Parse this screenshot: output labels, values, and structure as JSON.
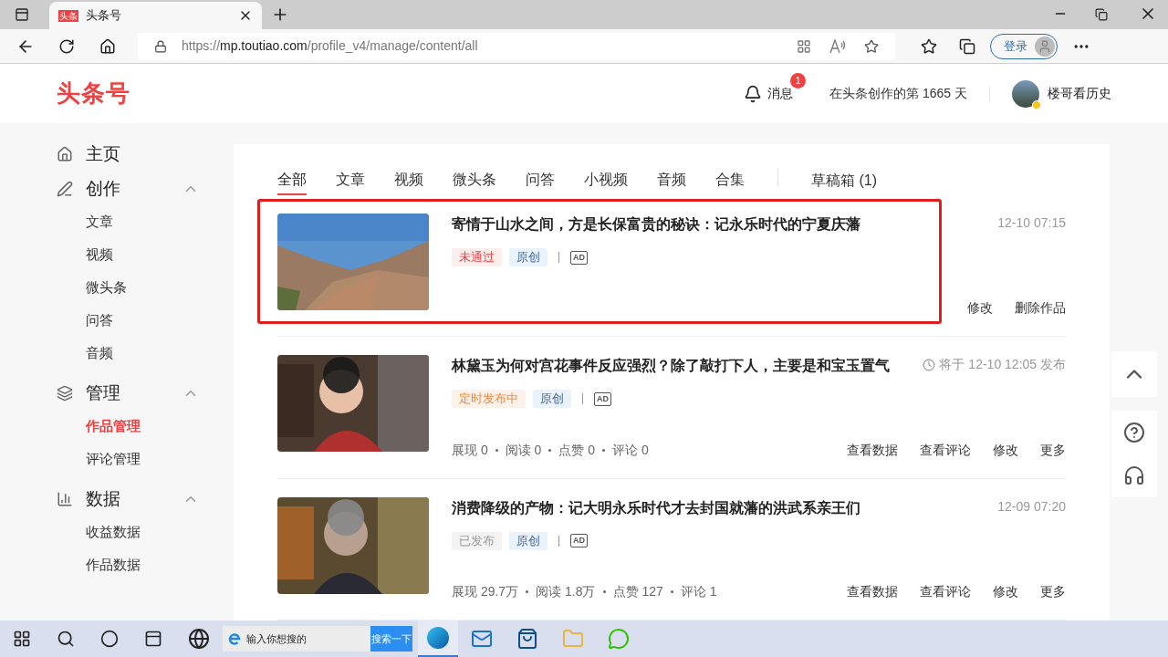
{
  "browser": {
    "tab_title": "头条号",
    "favicon": "头条",
    "url_host": "mp.toutiao.com",
    "url_scheme": "https://",
    "url_path": "/profile_v4/manage/content/all",
    "login": "登录"
  },
  "header": {
    "logo": "头条号",
    "messages": "消息",
    "message_count": "1",
    "days_text": "在头条创作的第 1665 天",
    "user": "楼哥看历史"
  },
  "sidebar": [
    {
      "label": "主页"
    },
    {
      "label": "创作",
      "expanded": true,
      "children": [
        {
          "label": "文章",
          "selected": false
        },
        {
          "label": "视频",
          "selected": false
        },
        {
          "label": "微头条",
          "selected": false
        },
        {
          "label": "问答",
          "selected": false
        },
        {
          "label": "音频",
          "selected": false
        }
      ]
    },
    {
      "label": "管理",
      "expanded": true,
      "children": [
        {
          "label": "作品管理",
          "selected": true
        },
        {
          "label": "评论管理",
          "selected": false
        }
      ]
    },
    {
      "label": "数据",
      "expanded": true,
      "children": [
        {
          "label": "收益数据",
          "selected": false
        },
        {
          "label": "作品数据",
          "selected": false
        }
      ]
    }
  ],
  "tabs": [
    {
      "label": "全部",
      "selected": true
    },
    {
      "label": "文章",
      "selected": false
    },
    {
      "label": "视频",
      "selected": false
    },
    {
      "label": "微头条",
      "selected": false
    },
    {
      "label": "问答",
      "selected": false
    },
    {
      "label": "小视频",
      "selected": false
    },
    {
      "label": "音频",
      "selected": false
    },
    {
      "label": "合集",
      "selected": false
    }
  ],
  "drafts": "草稿箱 (1)",
  "items": [
    {
      "title": "寄情于山水之间，方是长保富贵的秘诀：记永乐时代的宁夏庆藩",
      "status": "未通过",
      "kind": "rejected",
      "tag": "原创",
      "ad_label": "AD",
      "time": "12-10 07:15",
      "scheduled": false,
      "highlighted": true,
      "actions": [
        "修改",
        "删除作品"
      ]
    },
    {
      "title": "林黛玉为何对宫花事件反应强烈？除了敲打下人，主要是和宝玉置气",
      "status": "定时发布中",
      "kind": "scheduled",
      "tag": "原创",
      "ad_label": "AD",
      "time": "将于 12-10 12:05 发布",
      "scheduled": true,
      "highlighted": false,
      "stats": [
        "展现 0",
        "阅读 0",
        "点赞 0",
        "评论 0"
      ],
      "actions": [
        "查看数据",
        "查看评论",
        "修改",
        "更多"
      ]
    },
    {
      "title": "消费降级的产物：记大明永乐时代才去封国就藩的洪武系亲王们",
      "status": "已发布",
      "kind": "published",
      "tag": "原创",
      "ad_label": "AD",
      "time": "12-09 07:20",
      "scheduled": false,
      "highlighted": false,
      "stats": [
        "展现 29.7万",
        "阅读 1.8万",
        "点赞 127",
        "评论 1"
      ],
      "actions": [
        "查看数据",
        "查看评论",
        "修改",
        "更多"
      ]
    }
  ],
  "taskbar": {
    "search_placeholder": "输入你想搜的",
    "search_button": "搜索一下"
  }
}
